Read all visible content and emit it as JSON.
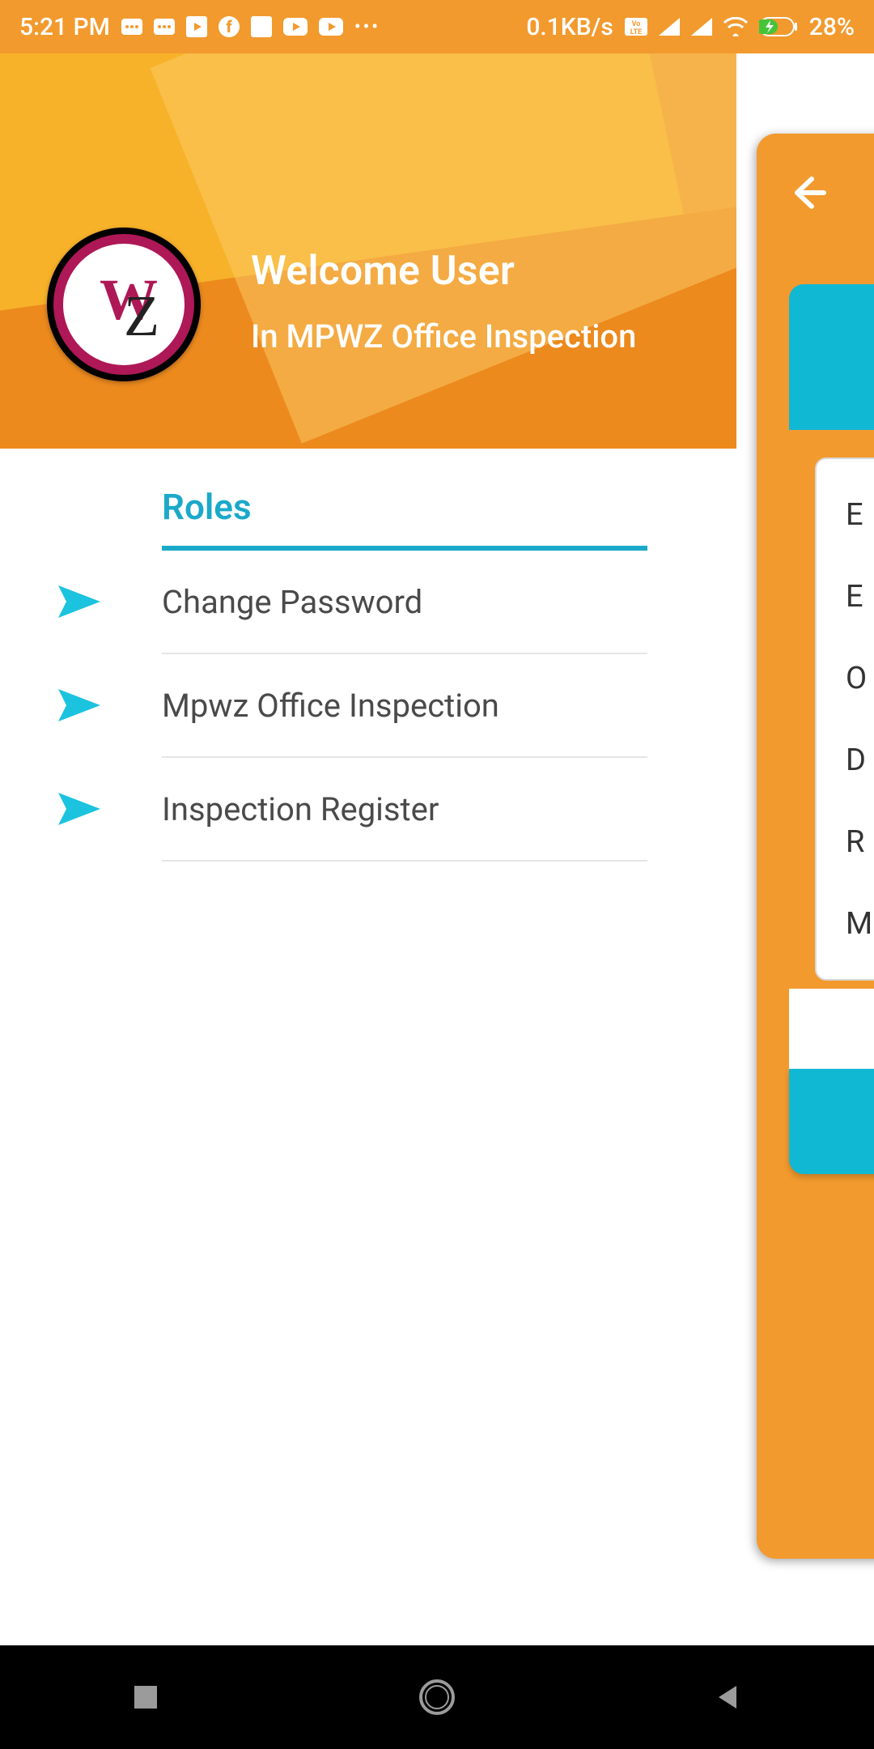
{
  "status_bar": {
    "time": "5:21 PM",
    "data_rate": "0.1KB/s",
    "battery_percent": "28%"
  },
  "drawer": {
    "welcome_line1": "Welcome User",
    "welcome_line2": "In MPWZ Office Inspection",
    "roles_header": "Roles",
    "items": [
      {
        "label": "Change Password"
      },
      {
        "label": "Mpwz Office Inspection"
      },
      {
        "label": "Inspection Register"
      }
    ]
  },
  "under_screen": {
    "fields": [
      {
        "label_fragment": "E"
      },
      {
        "label_fragment": "E"
      },
      {
        "label_fragment": "O"
      },
      {
        "label_fragment": "D"
      },
      {
        "label_fragment": "R"
      },
      {
        "label_fragment": "M"
      }
    ]
  },
  "colors": {
    "orange": "#F29A2E",
    "orange_light": "#F7B229",
    "orange_dark": "#EC8A1E",
    "teal": "#11B8D4",
    "teal_stroke": "#1BA9C9",
    "crimson": "#AE1857"
  }
}
